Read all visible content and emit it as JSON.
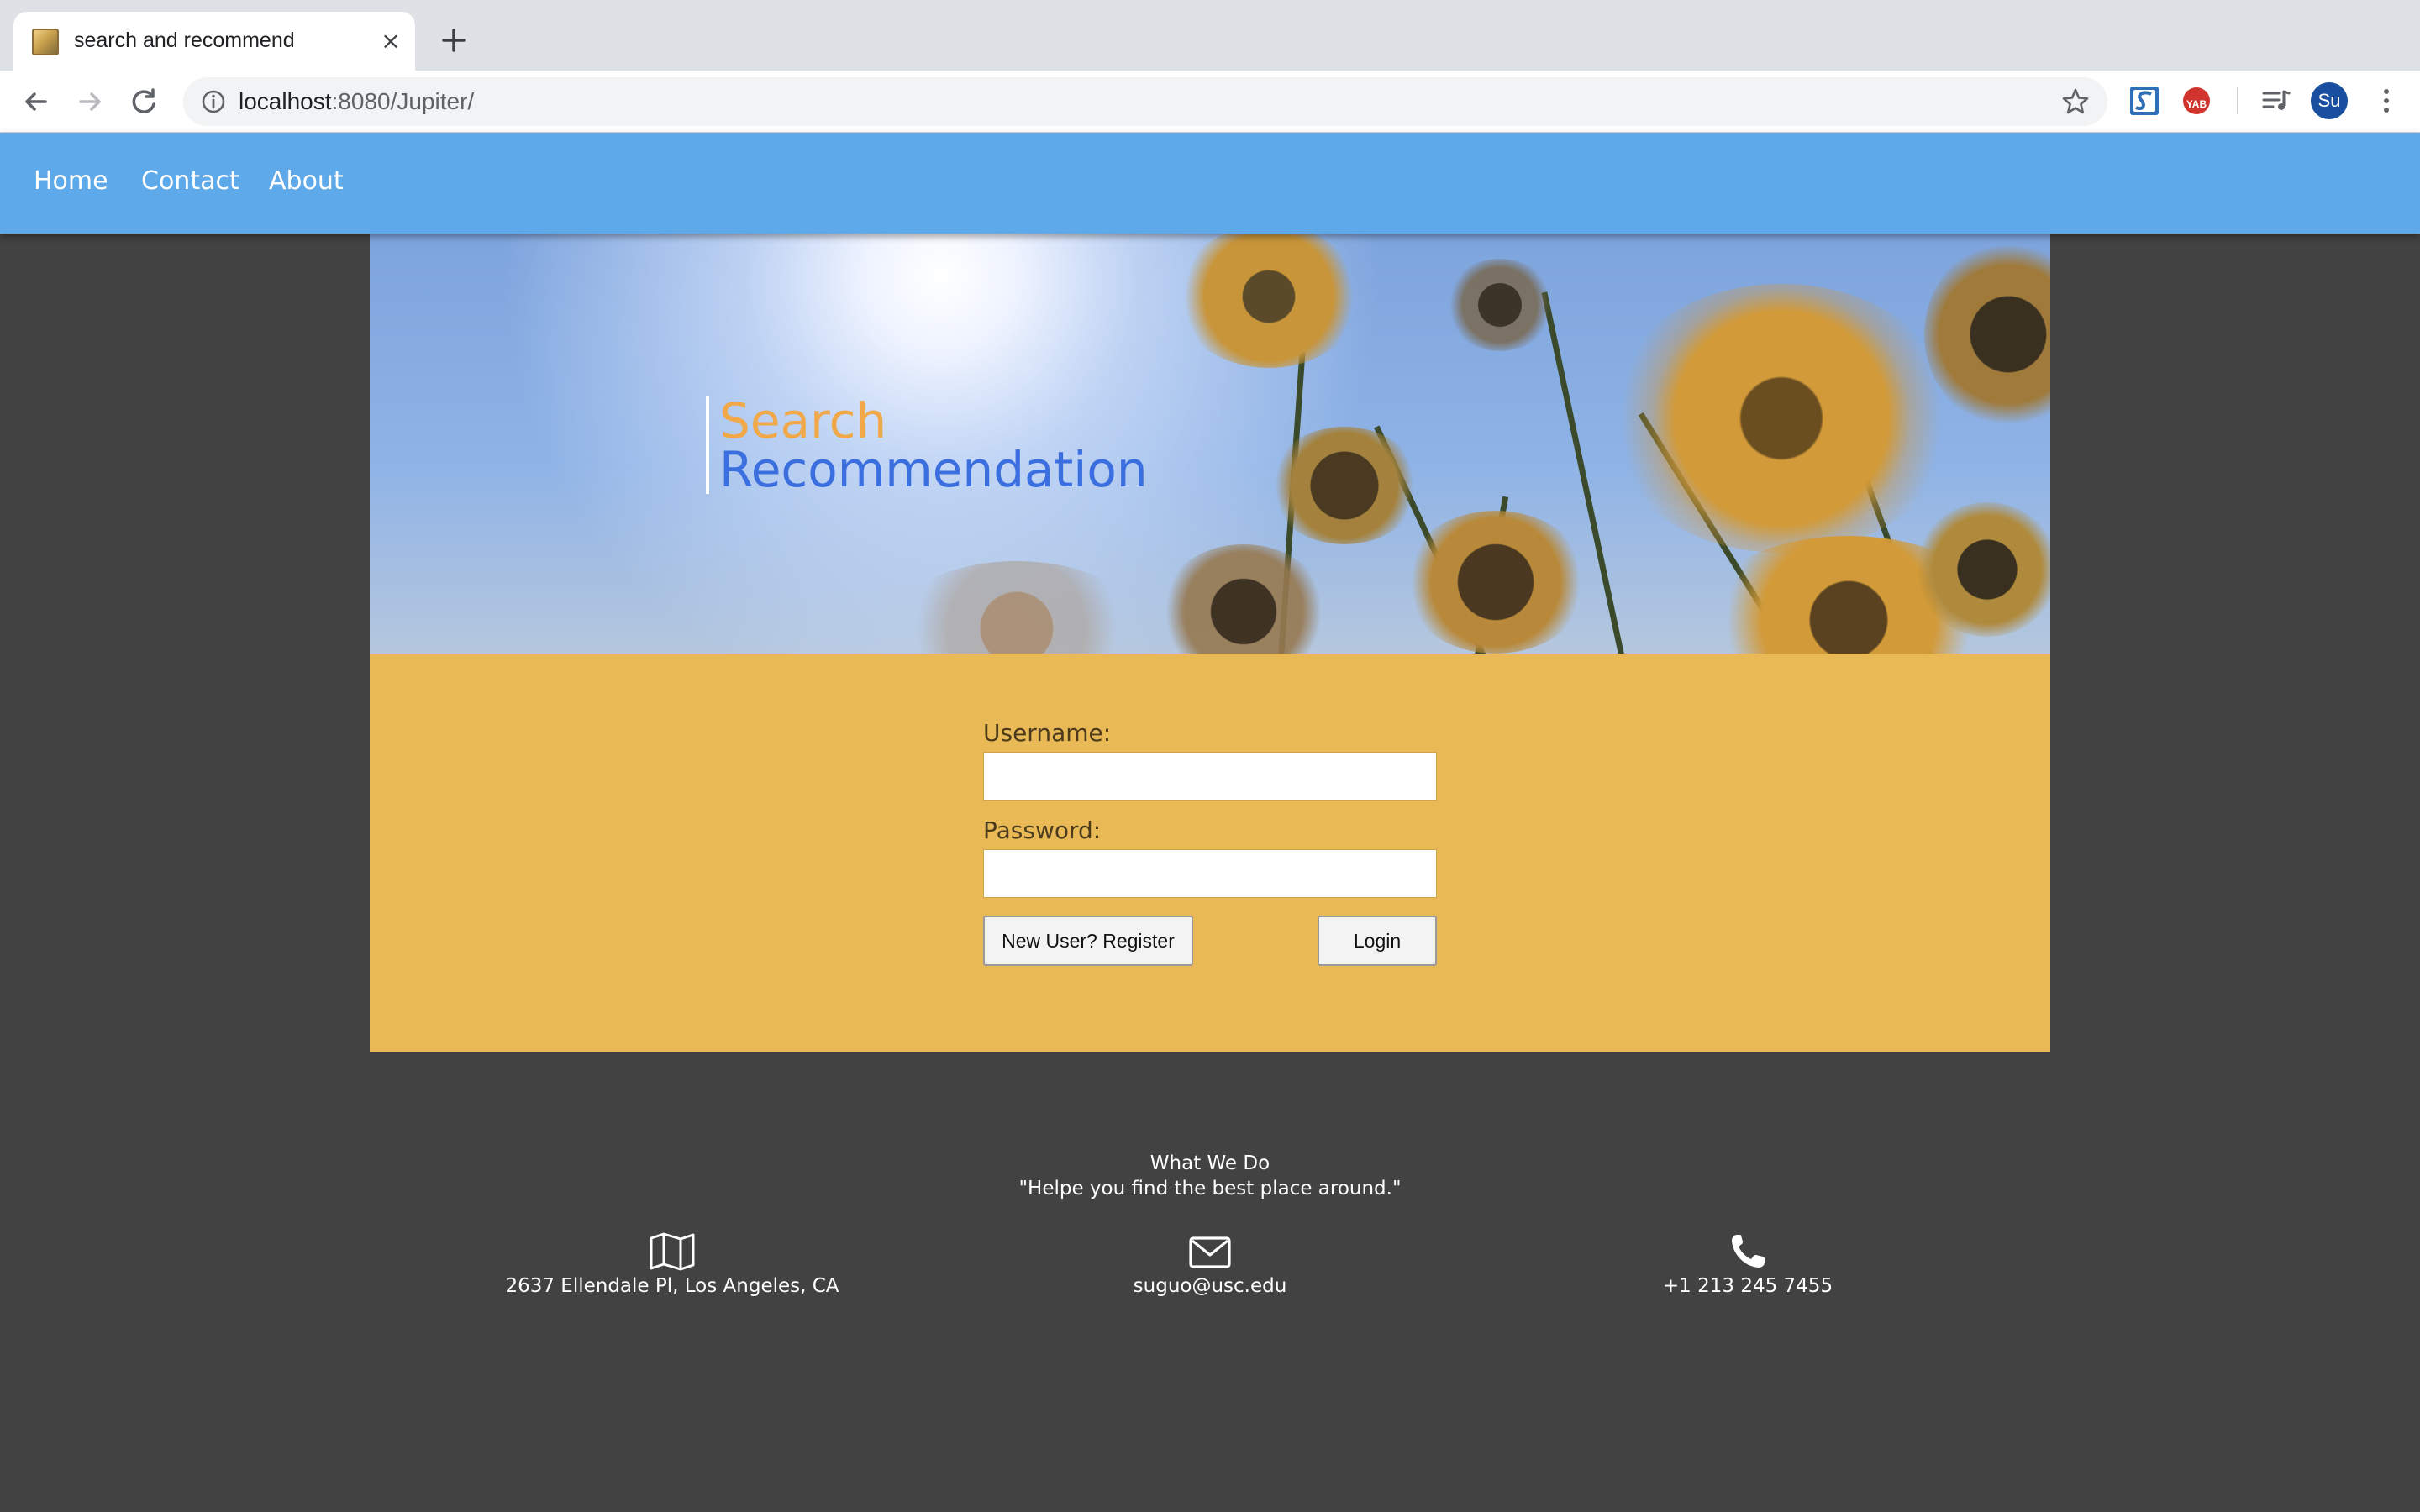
{
  "browser": {
    "tab_title": "search and recommend",
    "tab_close": "×",
    "url_host": "localhost",
    "url_path": ":8080/Jupiter/",
    "profile_initials": "Su",
    "extension_yab_label": "YAB"
  },
  "nav": {
    "items": [
      {
        "label": "Home"
      },
      {
        "label": "Contact"
      },
      {
        "label": "About"
      }
    ]
  },
  "hero": {
    "line1": "Search",
    "line2": "Recommendation"
  },
  "login": {
    "username_label": "Username:",
    "username_value": "",
    "password_label": "Password:",
    "password_value": "",
    "register_label": "New User? Register",
    "login_label": "Login"
  },
  "footer": {
    "heading": "What We Do",
    "tagline": "\"Helpe you find the best place around.\"",
    "address": "2637 Ellendale Pl, Los Angeles, CA",
    "email": "suguo@usc.edu",
    "phone": "+1 213 245 7455"
  },
  "colors": {
    "navbar": "#5ea9e9",
    "login_panel": "#e9b955",
    "page_background": "#424242",
    "hero_line1": "#f0a848",
    "hero_line2": "#3b6fe0"
  }
}
